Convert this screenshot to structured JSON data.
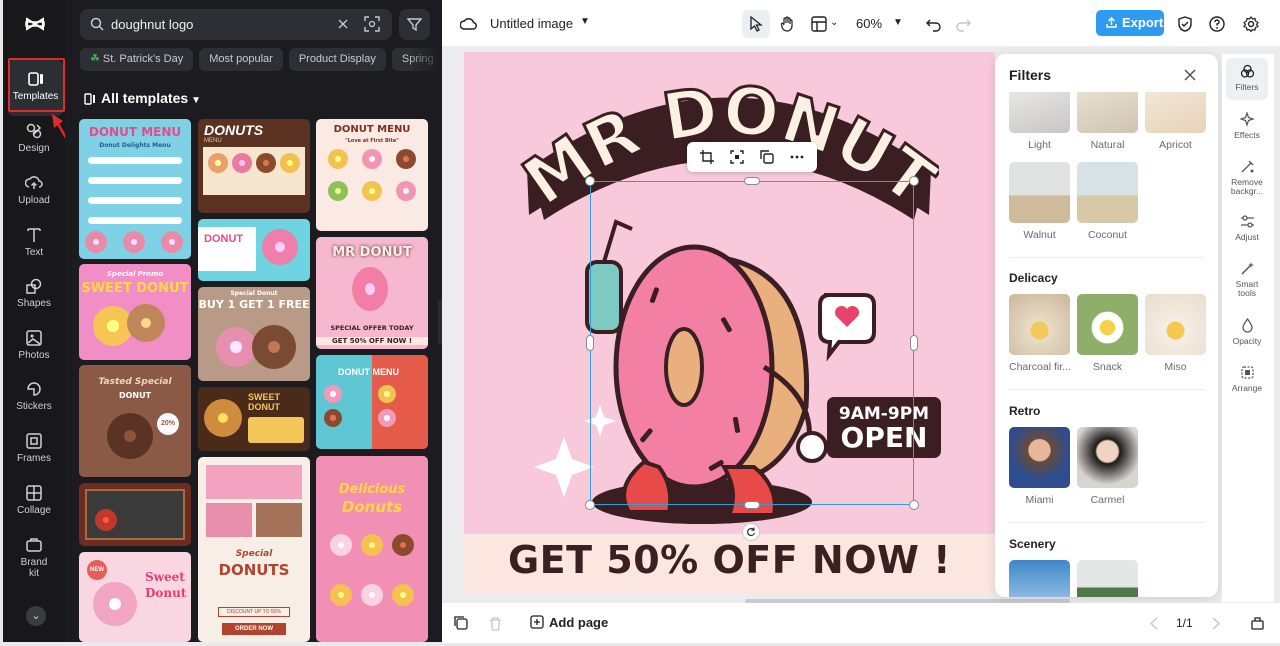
{
  "nav": {
    "items": [
      {
        "label": "Templates",
        "icon": "templates-icon"
      },
      {
        "label": "Design",
        "icon": "design-icon"
      },
      {
        "label": "Upload",
        "icon": "upload-icon"
      },
      {
        "label": "Text",
        "icon": "text-icon"
      },
      {
        "label": "Shapes",
        "icon": "shapes-icon"
      },
      {
        "label": "Photos",
        "icon": "photos-icon"
      },
      {
        "label": "Stickers",
        "icon": "stickers-icon"
      },
      {
        "label": "Frames",
        "icon": "frames-icon"
      },
      {
        "label": "Collage",
        "icon": "collage-icon"
      },
      {
        "label": "Brand",
        "label2": "kit",
        "icon": "brand-kit-icon"
      }
    ],
    "active": "Templates",
    "highlight_color": "#e12b2b"
  },
  "templates_panel": {
    "search_value": "doughnut logo",
    "chips": [
      "St. Patrick's Day",
      "Most popular",
      "Product Display",
      "Spring"
    ],
    "heading": "All templates",
    "thumbnails": {
      "t1": {
        "title": "DONUT MENU",
        "subtitle": "Donut Delights Menu"
      },
      "t2": {
        "title": "Special Promo",
        "subtitle": "SWEET DONUT"
      },
      "t3": {
        "title": "Tasted Special",
        "subtitle": "DONUT",
        "badge": "20%"
      },
      "t4": {
        "title": "DONUTS",
        "subtitle": "MENU"
      },
      "t5": {
        "title": "DONUT"
      },
      "t6": {
        "title": "Special Donut",
        "subtitle": "BUY 1 GET 1 FREE"
      },
      "t7": {
        "title": "SWEET DONUT"
      },
      "t8": {
        "title": "Special",
        "subtitle": "DONUTS",
        "cta": "ORDER NOW",
        "discount": "DISCOUNT UP TO 50%"
      },
      "t9": {
        "title": "DONUT MENU",
        "subtitle": "\"Love at First Bite\""
      },
      "t10": {
        "title": "MR DONUT",
        "subtitle": "SPECIAL OFFER TODAY",
        "cta": "GET 50% OFF NOW !"
      },
      "t11": {
        "title": "DONUT MENU"
      },
      "t12": {
        "title": "Delicious",
        "subtitle": "Donuts"
      },
      "t13": {
        "title": "Sweet",
        "subtitle": "Donut",
        "badge": "NEW"
      }
    }
  },
  "topbar": {
    "doc_title": "Untitled image",
    "zoom": "60%",
    "export_label": "Export",
    "accent": "#2d9cf0"
  },
  "artboard": {
    "title": "MR DONUT",
    "hours": "9AM-9PM",
    "open": "OPEN",
    "offer": "GET 50% OFF NOW !",
    "bg_color": "#f8c9da"
  },
  "filters": {
    "title": "Filters",
    "sections": [
      {
        "name": "",
        "items": [
          "Light",
          "Natural",
          "Apricot",
          "Walnut",
          "Coconut"
        ]
      },
      {
        "name": "Delicacy",
        "items": [
          "Charcoal fir...",
          "Snack",
          "Miso"
        ]
      },
      {
        "name": "Retro",
        "items": [
          "Miami",
          "Carmel"
        ]
      },
      {
        "name": "Scenery",
        "items": [
          "",
          ""
        ]
      }
    ]
  },
  "right_tools": [
    {
      "label": "Filters",
      "icon": "filters-icon"
    },
    {
      "label": "Effects",
      "icon": "effects-icon"
    },
    {
      "label": "Remove backgr...",
      "icon": "remove-background-icon"
    },
    {
      "label": "Adjust",
      "icon": "adjust-icon"
    },
    {
      "label": "Smart tools",
      "icon": "smart-tools-icon"
    },
    {
      "label": "Opacity",
      "icon": "opacity-icon"
    },
    {
      "label": "Arrange",
      "icon": "arrange-icon"
    }
  ],
  "bottombar": {
    "add_page": "Add page",
    "page_indicator": "1/1"
  }
}
